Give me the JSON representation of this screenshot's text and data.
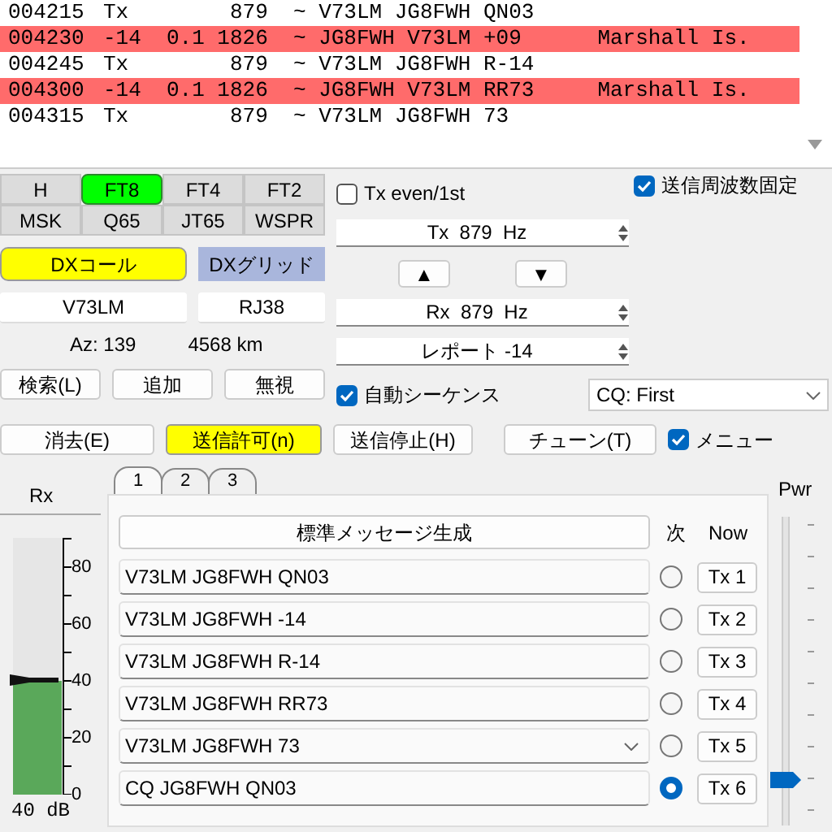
{
  "decodes": [
    {
      "time": "004215",
      "snr": "Tx",
      "freq": "879",
      "sep": "~",
      "message": "V73LM JG8FWH QN03",
      "highlighted": false
    },
    {
      "time": "004230",
      "snr": "-14",
      "dt": "0.1",
      "freq": "1826",
      "sep": "~",
      "message": "JG8FWH V73LM +09",
      "country": "Marshall Is.",
      "highlighted": true
    },
    {
      "time": "004245",
      "snr": "Tx",
      "freq": "879",
      "sep": "~",
      "message": "V73LM JG8FWH R-14",
      "highlighted": false
    },
    {
      "time": "004300",
      "snr": "-14",
      "dt": "0.1",
      "freq": "1826",
      "sep": "~",
      "message": "JG8FWH V73LM RR73",
      "country": "Marshall Is.",
      "highlighted": true
    },
    {
      "time": "004315",
      "snr": "Tx",
      "freq": "879",
      "sep": "~",
      "message": "V73LM JG8FWH 73",
      "highlighted": false
    }
  ],
  "modes": [
    {
      "label": "H",
      "selected": false
    },
    {
      "label": "FT8",
      "selected": true
    },
    {
      "label": "FT4",
      "selected": false
    },
    {
      "label": "FT2",
      "selected": false
    },
    {
      "label": "MSK",
      "selected": false
    },
    {
      "label": "Q65",
      "selected": false
    },
    {
      "label": "JT65",
      "selected": false
    },
    {
      "label": "WSPR",
      "selected": false
    }
  ],
  "dx_call_button": "DXコール",
  "dx_grid_button": "DXグリッド",
  "dx_call": "V73LM",
  "dx_grid": "RJ38",
  "azimuth": "Az: 139",
  "distance": "4568 km",
  "lookup_buttons": [
    "検索(L)",
    "追加",
    "無視"
  ],
  "tx_even": {
    "label": "Tx even/1st",
    "checked": false
  },
  "hold_tx_freq": {
    "label": "送信周波数固定",
    "checked": true
  },
  "tx_freq": "Tx  879  Hz",
  "up_button": "▲",
  "down_button": "▼",
  "rx_freq": "Rx  879  Hz",
  "report": "レポート -14",
  "auto_seq": {
    "label": "自動シーケンス",
    "checked": true
  },
  "cq_select": "CQ: First",
  "action_buttons": [
    {
      "label": "消去(E)",
      "highlighted": false
    },
    {
      "label": "送信許可(n)",
      "highlighted": true
    },
    {
      "label": "送信停止(H)",
      "highlighted": false
    },
    {
      "label": "チューン(T)",
      "highlighted": false
    }
  ],
  "menu": {
    "label": "メニュー",
    "checked": true
  },
  "rx_meter": {
    "label": "Rx",
    "scale": [
      "80",
      "60",
      "40",
      "20",
      "0"
    ],
    "level": 0.444,
    "reading": "40 dB"
  },
  "message_tabs": [
    {
      "label": "1",
      "selected": true
    },
    {
      "label": "2",
      "selected": false
    },
    {
      "label": "3",
      "selected": false
    }
  ],
  "generate_button": "標準メッセージ生成",
  "next_header": "次",
  "now_header": "Now",
  "messages": [
    {
      "text": "V73LM JG8FWH QN03",
      "kind": "field",
      "next": false,
      "tx_button": "Tx 1"
    },
    {
      "text": "V73LM JG8FWH -14",
      "kind": "field",
      "next": false,
      "tx_button": "Tx 2"
    },
    {
      "text": "V73LM JG8FWH R-14",
      "kind": "field",
      "next": false,
      "tx_button": "Tx 3"
    },
    {
      "text": "V73LM JG8FWH RR73",
      "kind": "field",
      "next": false,
      "tx_button": "Tx 4"
    },
    {
      "text": "V73LM JG8FWH 73",
      "kind": "dropdown",
      "next": false,
      "tx_button": "Tx 5"
    },
    {
      "text": "CQ JG8FWH QN03",
      "kind": "field",
      "next": true,
      "tx_button": "Tx 6"
    }
  ],
  "power": {
    "label": "Pwr",
    "level": 0.15
  }
}
